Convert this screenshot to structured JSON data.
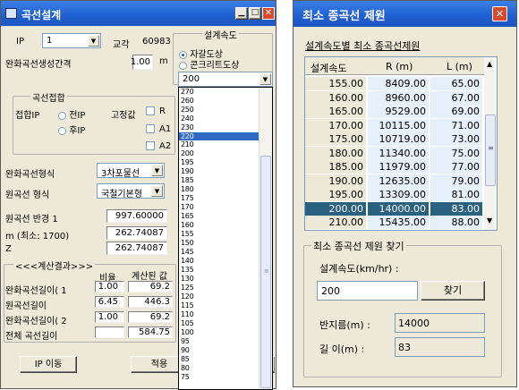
{
  "left_window": {
    "title": "곡선설계",
    "ip_label": "IP",
    "ip_value": "1",
    "intersection_label": "교각",
    "intersection_value": "60983",
    "transition_spacing_label": "완화곡선생성간격",
    "transition_spacing_value": "1.00",
    "transition_spacing_unit": "m",
    "design_speed_group": "설계속도",
    "radio_gravel": "자갈도상",
    "radio_concrete": "콘크리트도상",
    "speed_select_value": "200",
    "speed_options": [
      "270",
      "260",
      "250",
      "240",
      "230",
      "220",
      "210",
      "200",
      "195",
      "190",
      "185",
      "180",
      "175",
      "170",
      "165",
      "160",
      "155",
      "150",
      "145",
      "140",
      "135",
      "130",
      "125",
      "120",
      "115",
      "110",
      "105",
      "100",
      "95",
      "90",
      "85",
      "80",
      "75"
    ],
    "speed_selected": "220",
    "contact_group": "곡선접합",
    "contact_ip_label": "접합IP",
    "radio_prev_ip": "전IP",
    "radio_next_ip": "후IP",
    "fixed_label": "고정값",
    "chk_r": "R",
    "chk_a1": "A1",
    "chk_a2": "A2",
    "transition_type_label": "완화곡선형식",
    "transition_type_value": "3차포물선",
    "circular_type_label": "원곡선 형식",
    "circular_type_value": "국철기본형",
    "radius_label": "원곡선 반경 1",
    "radius_value": "997.60000",
    "m_label": "m (최소: 1700)",
    "m_value": "262.74087",
    "z_label": "Z",
    "z_value": "262.74087",
    "calc_group": "<<<계산결과>>>",
    "col_ratio": "비율",
    "col_calc": "계산된 값",
    "results": [
      {
        "label": "완화곡선길이( 1",
        "ratio": "1.00",
        "value": "69.2"
      },
      {
        "label": "원곡선길이",
        "ratio": "6.45",
        "value": "446.3"
      },
      {
        "label": "완화곡선길이( 2",
        "ratio": "1.00",
        "value": "69.2"
      },
      {
        "label": "전체 곡선길이",
        "ratio": "",
        "value": "584.75"
      }
    ],
    "ip_move_button": "IP 이동",
    "apply_button": "적용"
  },
  "right_window": {
    "title": "최소 종곡선 제원",
    "table_caption": "설계속도별 최소 종곡선제원",
    "headers": [
      "설계속도",
      "R (m)",
      "L (m)"
    ],
    "rows": [
      [
        "155.00",
        "8409.00",
        "65.00"
      ],
      [
        "160.00",
        "8960.00",
        "67.00"
      ],
      [
        "165.00",
        "9529.00",
        "69.00"
      ],
      [
        "170.00",
        "10115.00",
        "71.00"
      ],
      [
        "175.00",
        "10719.00",
        "73.00"
      ],
      [
        "180.00",
        "11340.00",
        "75.00"
      ],
      [
        "185.00",
        "11979.00",
        "77.00"
      ],
      [
        "190.00",
        "12635.00",
        "79.00"
      ],
      [
        "195.00",
        "13309.00",
        "81.00"
      ],
      [
        "200.00",
        "14000.00",
        "83.00"
      ],
      [
        "210.00",
        "15435.00",
        "88.00"
      ]
    ],
    "selected_row": 9,
    "search_group": "최소 종곡선 제원 찾기",
    "speed_label": "설계속도(km/hr) :",
    "speed_input": "200",
    "find_button": "찾기",
    "radius_label": "반지름(m) :",
    "radius_value": "14000",
    "length_label": "길  이(m) :",
    "length_value": "83"
  }
}
